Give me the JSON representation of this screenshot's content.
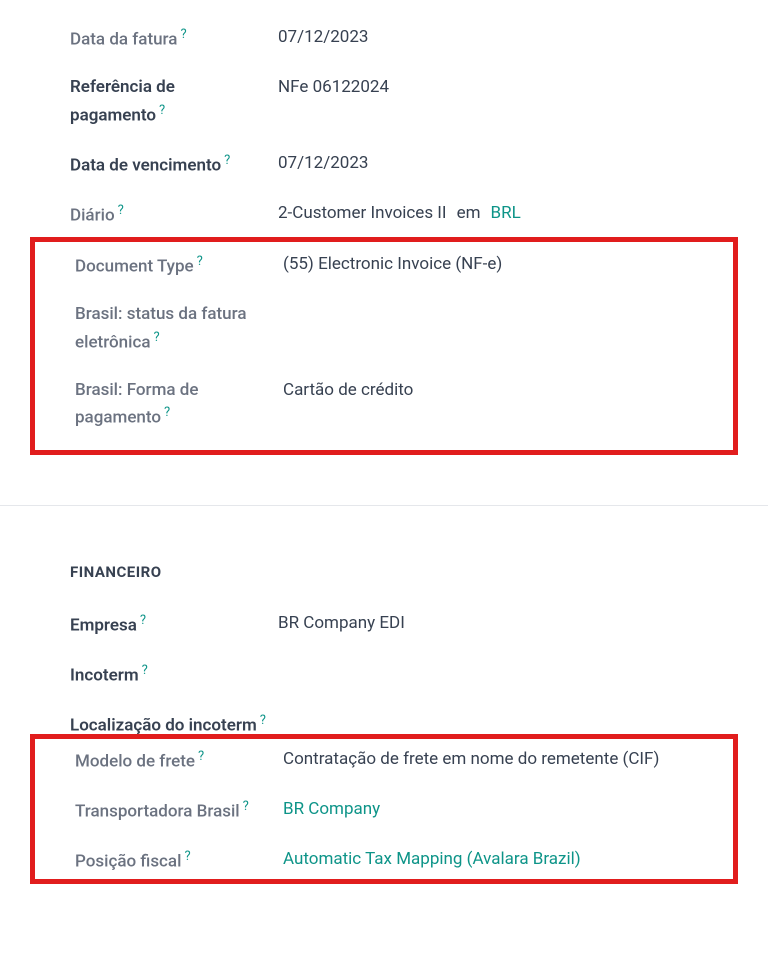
{
  "fields": {
    "invoice_date": {
      "label": "Data da fatura",
      "value": "07/12/2023"
    },
    "payment_ref": {
      "label": "Referência de pagamento",
      "value": "NFe 06122024"
    },
    "due_date": {
      "label": "Data de vencimento",
      "value": "07/12/2023"
    },
    "journal": {
      "label": "Diário",
      "value_main": "2-Customer Invoices II",
      "value_em": "em",
      "value_currency": "BRL"
    },
    "document_type": {
      "label": "Document Type",
      "value": "(55) Electronic Invoice (NF-e)"
    },
    "einvoice_status": {
      "label": "Brasil: status da fatura eletrônica",
      "value": ""
    },
    "payment_method": {
      "label": "Brasil: Forma de pagamento",
      "value": "Cartão de crédito"
    }
  },
  "financial": {
    "header": "Financeiro",
    "company": {
      "label": "Empresa",
      "value": "BR Company EDI"
    },
    "incoterm": {
      "label": "Incoterm",
      "value": ""
    },
    "incoterm_location": {
      "label": "Localização do incoterm",
      "value": ""
    },
    "freight_model": {
      "label": "Modelo de frete",
      "value": "Contratação de frete em nome do remetente (CIF)"
    },
    "carrier_brazil": {
      "label": "Transportadora Brasil",
      "value": "BR Company"
    },
    "fiscal_position": {
      "label": "Posição fiscal",
      "value": "Automatic Tax Mapping (Avalara Brazil)"
    }
  }
}
